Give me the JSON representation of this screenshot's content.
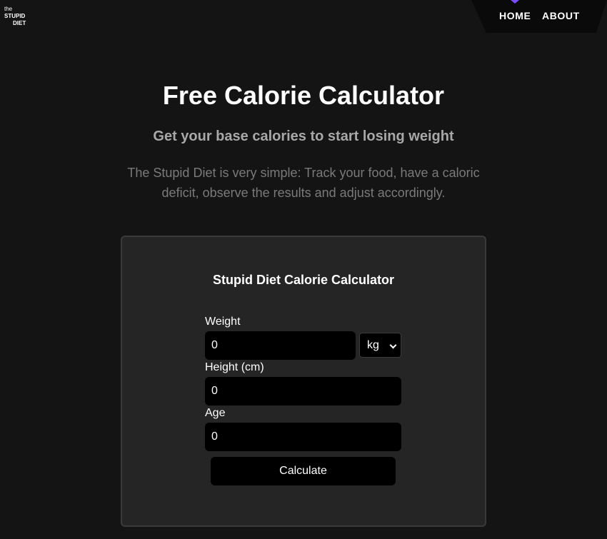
{
  "logo": {
    "line1": "the",
    "line2": "STUPID",
    "line3": "DIET"
  },
  "nav": {
    "home": "HOME",
    "about": "ABOUT",
    "accent_color": "#7b4dff"
  },
  "hero": {
    "title": "Free Calorie Calculator",
    "subtitle": "Get your base calories to start losing weight",
    "description": "The Stupid Diet is very simple: Track your food, have a caloric deficit, observe the results and adjust accordingly."
  },
  "calculator": {
    "title": "Stupid Diet Calorie Calculator",
    "weight_label": "Weight",
    "weight_value": "0",
    "unit_selected": "kg",
    "height_label": "Height (cm)",
    "height_value": "0",
    "age_label": "Age",
    "age_value": "0",
    "submit_label": "Calculate"
  }
}
